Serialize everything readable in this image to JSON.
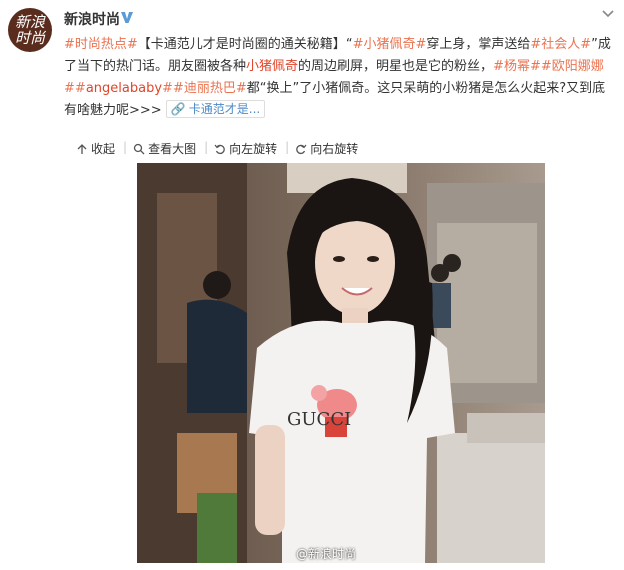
{
  "post": {
    "author": "新浪时尚",
    "avatar_line1": "新浪",
    "avatar_line2": "时尚",
    "body": {
      "tag_fashion": "#时尚热点#",
      "lead": "【卡通范儿才是时尚圈的通关秘籍】",
      "quote_open": "“",
      "tag_peppa": "#小猪佩奇#",
      "t1": "穿上身，掌声送给",
      "tag_social": "#社会人#",
      "t2": "”成了当下的热门话。朋友圈被各种",
      "peppa_plain": "小猪佩奇",
      "t3": "的周边刷屏，明星也是它的粉丝，",
      "tag_yangmi": "#杨幂#",
      "tag_ouyang": "#欧阳娜娜#",
      "tag_angela_open": "#",
      "tag_angela_name": "angelababy",
      "tag_angela_close": "#",
      "tag_dilireba": "#迪丽热巴#",
      "t4": "都“换上”了小猪佩奇。这只呆萌的小粉猪是怎么火起来?又到底有啥魅力呢>>>",
      "link_text": "卡通范才是..."
    }
  },
  "toolbar": {
    "collect": "收起",
    "view_large": "查看大图",
    "rotate_left": "向左旋转",
    "rotate_right": "向右旋转"
  },
  "photo": {
    "watermark": "@新浪时尚",
    "shirt_text": "GUCCI"
  },
  "colors": {
    "tag_orange": "#eb7350",
    "link_blue": "#4e8bc7",
    "verified_blue": "#5b9bd5"
  }
}
